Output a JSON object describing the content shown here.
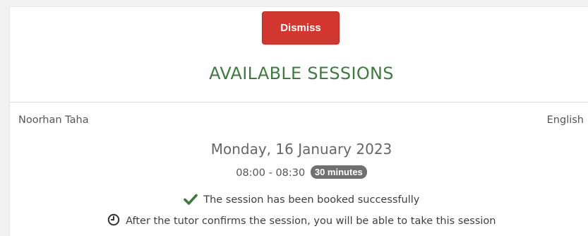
{
  "dismiss_button": {
    "label": "Dismiss",
    "color": "#d1372e"
  },
  "heading": "AVAILABLE SESSIONS",
  "heading_color": "#3f7b3f",
  "session": {
    "tutor": "Noorhan Taha",
    "language": "English",
    "date": "Monday, 16 January 2023",
    "time_range": "08:00 - 08:30",
    "duration_badge": "30 minutes",
    "status_icon": "check-icon",
    "status_message": "The session has been booked successfully",
    "info_icon": "clock-icon",
    "info_message": "After the tutor confirms the session, you will be able to take this session"
  }
}
